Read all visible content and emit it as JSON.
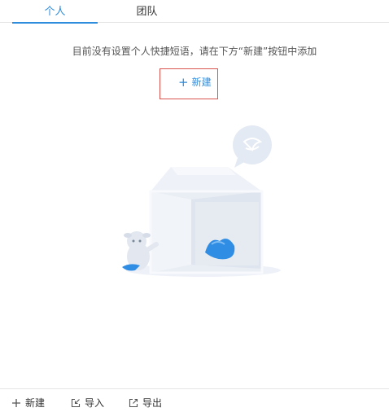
{
  "tabs": [
    {
      "label": "个人",
      "active": true
    },
    {
      "label": "团队",
      "active": false
    }
  ],
  "empty_state": {
    "message": "目前没有设置个人快捷短语，请在下方“新建”按钮中添加",
    "new_button_label": "新建"
  },
  "bottom_bar": {
    "new_label": "新建",
    "import_label": "导入",
    "export_label": "导出"
  },
  "colors": {
    "accent": "#2e8ddd",
    "highlight_border": "#d9534f"
  }
}
